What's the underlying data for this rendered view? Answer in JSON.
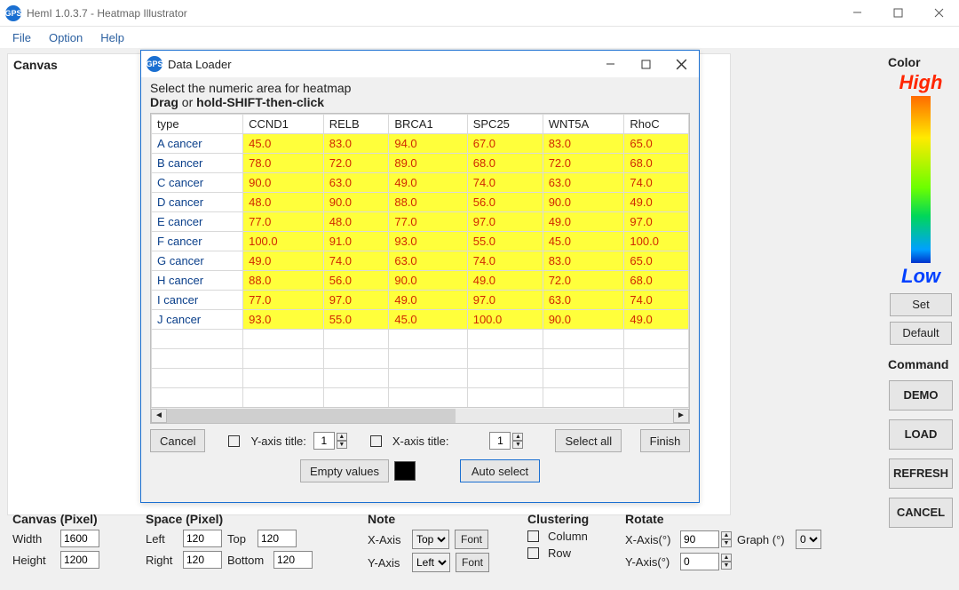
{
  "window": {
    "title": "HemI 1.0.3.7 - Heatmap Illustrator",
    "logo_text": "GPS"
  },
  "menu": {
    "items": [
      "File",
      "Option",
      "Help"
    ]
  },
  "canvas": {
    "label": "Canvas"
  },
  "dialog": {
    "title": "Data Loader",
    "instr_line1": "Select the numeric area for heatmap",
    "instr_line2_a": "Drag",
    "instr_line2_b": " or ",
    "instr_line2_c": "hold-SHIFT-then-click",
    "buttons": {
      "cancel": "Cancel",
      "yaxis": "Y-axis title:",
      "xaxis": "X-axis title:",
      "select_all": "Select all",
      "finish": "Finish",
      "empty": "Empty values",
      "auto": "Auto select"
    },
    "spin1": "1",
    "spin2": "1"
  },
  "chart_data": {
    "type": "table",
    "row_header_name": "type",
    "columns": [
      "CCND1",
      "RELB",
      "BRCA1",
      "SPC25",
      "WNT5A",
      "RhoC"
    ],
    "rows": [
      {
        "name": "A cancer",
        "values": [
          45.0,
          83.0,
          94.0,
          67.0,
          83.0,
          65.0
        ]
      },
      {
        "name": "B cancer",
        "values": [
          78.0,
          72.0,
          89.0,
          68.0,
          72.0,
          68.0
        ]
      },
      {
        "name": "C cancer",
        "values": [
          90.0,
          63.0,
          49.0,
          74.0,
          63.0,
          74.0
        ]
      },
      {
        "name": "D cancer",
        "values": [
          48.0,
          90.0,
          88.0,
          56.0,
          90.0,
          49.0
        ]
      },
      {
        "name": "E cancer",
        "values": [
          77.0,
          48.0,
          77.0,
          97.0,
          49.0,
          97.0
        ]
      },
      {
        "name": "F cancer",
        "values": [
          100.0,
          91.0,
          93.0,
          55.0,
          45.0,
          100.0
        ]
      },
      {
        "name": "G cancer",
        "values": [
          49.0,
          74.0,
          63.0,
          74.0,
          83.0,
          65.0
        ]
      },
      {
        "name": "H cancer",
        "values": [
          88.0,
          56.0,
          90.0,
          49.0,
          72.0,
          68.0
        ]
      },
      {
        "name": "I cancer",
        "values": [
          77.0,
          97.0,
          49.0,
          97.0,
          63.0,
          74.0
        ]
      },
      {
        "name": "J cancer",
        "values": [
          93.0,
          55.0,
          45.0,
          100.0,
          90.0,
          49.0
        ]
      }
    ]
  },
  "right": {
    "color_heading": "Color",
    "high": "High",
    "low": "Low",
    "set": "Set",
    "default": "Default",
    "command_heading": "Command",
    "cmds": [
      "DEMO",
      "LOAD",
      "REFRESH",
      "CANCEL"
    ]
  },
  "bottom": {
    "canvas": {
      "title": "Canvas (Pixel)",
      "width_lbl": "Width",
      "width": "1600",
      "height_lbl": "Height",
      "height": "1200"
    },
    "space": {
      "title": "Space (Pixel)",
      "left_lbl": "Left",
      "left": "120",
      "top_lbl": "Top",
      "top": "120",
      "right_lbl": "Right",
      "right": "120",
      "bottom_lbl": "Bottom",
      "bottom": "120"
    },
    "note": {
      "title": "Note",
      "xaxis_lbl": "X-Axis",
      "xaxis_sel": "Top",
      "yaxis_lbl": "Y-Axis",
      "yaxis_sel": "Left",
      "font": "Font"
    },
    "cluster": {
      "title": "Clustering",
      "col": "Column",
      "row": "Row"
    },
    "rotate": {
      "title": "Rotate",
      "xa": "X-Axis(°)",
      "xv": "90",
      "ya": "Y-Axis(°)",
      "yv": "0",
      "g": "Graph (°)",
      "gv": "0"
    }
  }
}
